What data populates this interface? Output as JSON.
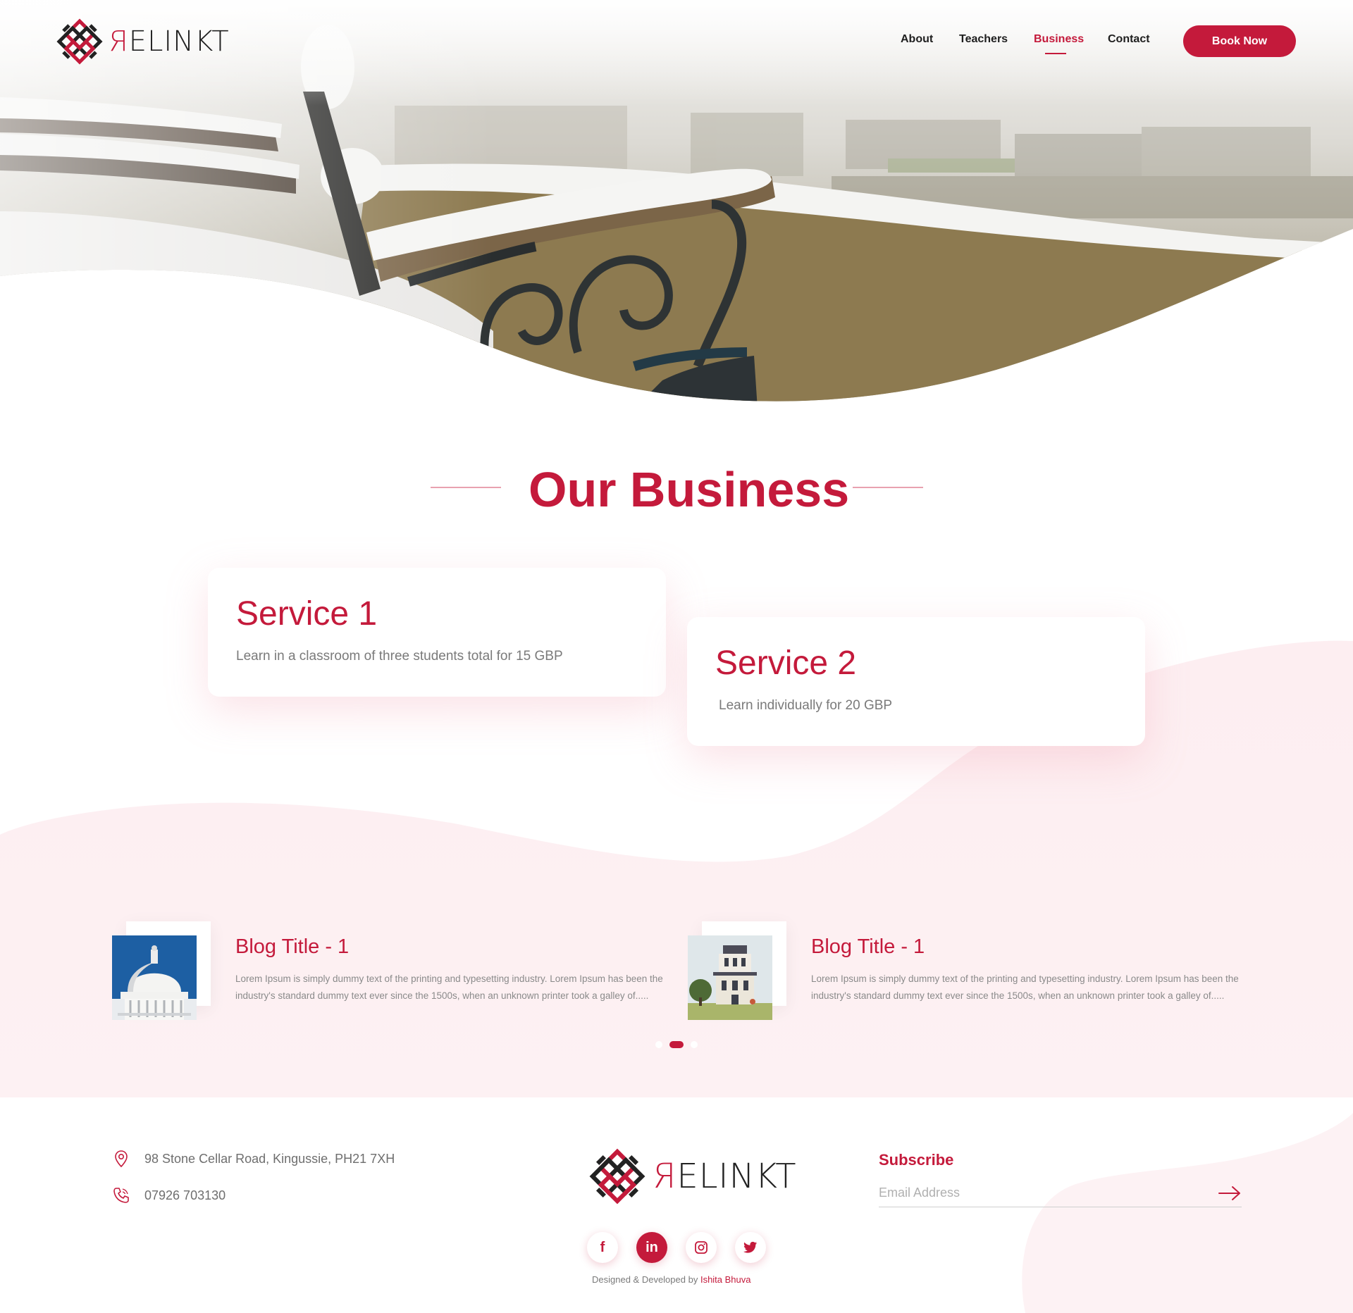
{
  "brand": {
    "logo_text": "ELINKT",
    "accent_color": "#c41a3b",
    "dark_color": "#222222"
  },
  "nav": {
    "links": [
      {
        "label": "About",
        "active": false
      },
      {
        "label": "Teachers",
        "active": false
      },
      {
        "label": "Business",
        "active": true
      },
      {
        "label": "Contact",
        "active": false
      }
    ],
    "cta_label": "Book Now"
  },
  "hero": {
    "image_subject": "snow-covered park bench overlooking city"
  },
  "business": {
    "title": "Our Business",
    "services": [
      {
        "title": "Service 1",
        "description": "Learn in a classroom of three students total for 15 GBP"
      },
      {
        "title": "Service 2",
        "description": "Learn individually for 20 GBP"
      }
    ]
  },
  "blogs": {
    "items": [
      {
        "title": "Blog Title - 1",
        "text": "Lorem Ipsum is simply dummy text of the printing and typesetting industry. Lorem Ipsum has been the industry's standard dummy text ever since the 1500s, when an unknown printer took a galley of.....",
        "thumb_icon": "dome-building-image"
      },
      {
        "title": "Blog Title - 1",
        "text": "Lorem Ipsum is simply dummy text of the printing and typesetting industry. Lorem Ipsum has been the industry's standard dummy text ever since the 1500s, when an unknown printer took a galley of.....",
        "thumb_icon": "victorian-house-image"
      }
    ],
    "carousel_active_index": 1,
    "carousel_count": 3
  },
  "footer": {
    "address": "98 Stone Cellar Road, Kingussie, PH21 7XH",
    "phone": "07926 703130",
    "address_icon": "location-pin-icon",
    "phone_icon": "phone-icon",
    "socials": [
      {
        "icon": "facebook-icon",
        "glyph": "f"
      },
      {
        "icon": "linkedin-icon",
        "glyph": "in"
      },
      {
        "icon": "instagram-icon",
        "glyph": ""
      },
      {
        "icon": "twitter-icon",
        "glyph": ""
      }
    ],
    "credit_prefix": "Designed & Developed by",
    "credit_author": "Ishita Bhuva",
    "subscribe_label": "Subscribe",
    "email_placeholder": "Email Address"
  }
}
